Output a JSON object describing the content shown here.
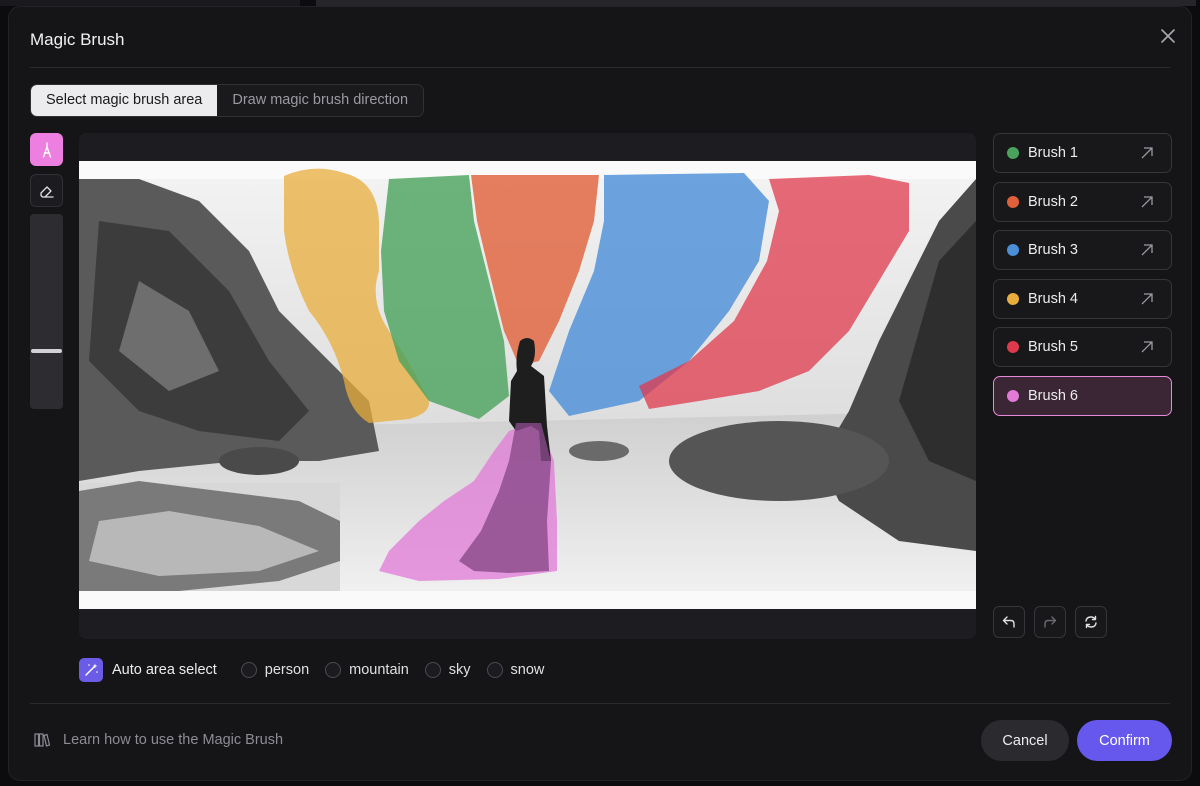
{
  "dialog": {
    "title": "Magic Brush"
  },
  "tabs": [
    {
      "label": "Select magic brush area",
      "active": true
    },
    {
      "label": "Draw magic brush direction",
      "active": false
    }
  ],
  "tools": {
    "brush_icon": "brush-icon",
    "eraser_icon": "eraser-icon",
    "size_level": 0.3
  },
  "brushes": [
    {
      "label": "Brush 1",
      "color": "#4aa35c"
    },
    {
      "label": "Brush 2",
      "color": "#e0603a"
    },
    {
      "label": "Brush 3",
      "color": "#4a8fd8"
    },
    {
      "label": "Brush 4",
      "color": "#e8ad3c"
    },
    {
      "label": "Brush 5",
      "color": "#df3a4c"
    },
    {
      "label": "Brush 6",
      "color": "#e27ad8"
    }
  ],
  "history": {
    "undo_icon": "undo-icon",
    "redo_icon": "redo-icon",
    "reset_icon": "reset-icon"
  },
  "auto_select": {
    "label": "Auto area select",
    "options": [
      "person",
      "mountain",
      "sky",
      "snow"
    ]
  },
  "footer": {
    "learn_text": "Learn how to use the Magic Brush",
    "cancel_label": "Cancel",
    "confirm_label": "Confirm"
  },
  "colors": {
    "accent": "#6658ec",
    "active_brush": "#e88ad9",
    "modal_bg": "#151518"
  }
}
